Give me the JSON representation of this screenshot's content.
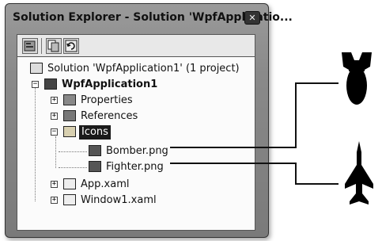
{
  "window": {
    "title": "Solution Explorer - Solution 'WpfApplicatio...",
    "close_glyph": "✕"
  },
  "toolbar": {
    "buttons": [
      {
        "icon": "properties-icon"
      },
      {
        "icon": "show-all-files-icon"
      },
      {
        "icon": "refresh-icon"
      }
    ]
  },
  "tree": {
    "solution": "Solution 'WpfApplication1' (1 project)",
    "project": "WpfApplication1",
    "items": [
      {
        "label": "Properties",
        "expander": "+"
      },
      {
        "label": "References",
        "expander": "+"
      },
      {
        "label": "Icons",
        "expander": "−"
      }
    ],
    "icon_files": [
      {
        "label": "Bomber.png"
      },
      {
        "label": "Fighter.png"
      }
    ],
    "bottom_items": [
      {
        "label": "App.xaml",
        "expander": "+"
      },
      {
        "label": "Window1.xaml",
        "expander": "+"
      }
    ],
    "project_expander": "−"
  },
  "callouts": [
    {
      "target": "Bomber.png",
      "graphic": "bomb-icon"
    },
    {
      "target": "Fighter.png",
      "graphic": "fighter-jet-icon"
    }
  ]
}
